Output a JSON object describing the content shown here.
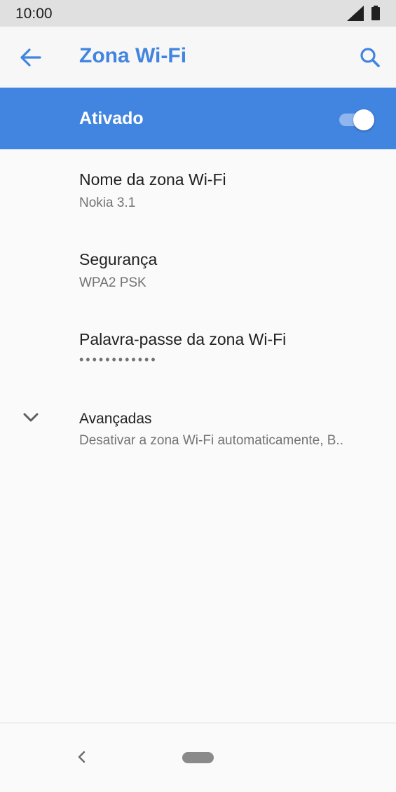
{
  "status_bar": {
    "time": "10:00",
    "icons": [
      "signal-icon",
      "battery-icon"
    ]
  },
  "app_bar": {
    "title": "Zona Wi-Fi",
    "back_icon": "arrow-left-icon",
    "search_icon": "search-icon"
  },
  "master_switch": {
    "label": "Ativado",
    "state": "on"
  },
  "items": [
    {
      "title": "Nome da zona Wi-Fi",
      "summary": "Nokia 3.1"
    },
    {
      "title": "Segurança",
      "summary": "WPA2 PSK"
    },
    {
      "title": "Palavra-passe da zona Wi-Fi",
      "summary": "••••••••••••"
    },
    {
      "title": "Avançadas",
      "summary": "Desativar a zona Wi-Fi automaticamente, B..",
      "icon": "chevron-down-icon"
    }
  ],
  "nav_bar": {
    "back_icon": "chevron-left-icon",
    "home_icon": "home-pill-icon"
  },
  "colors": {
    "accent": "#4285e0",
    "status_bar": "#e0e0e0",
    "background": "#fafafa"
  }
}
